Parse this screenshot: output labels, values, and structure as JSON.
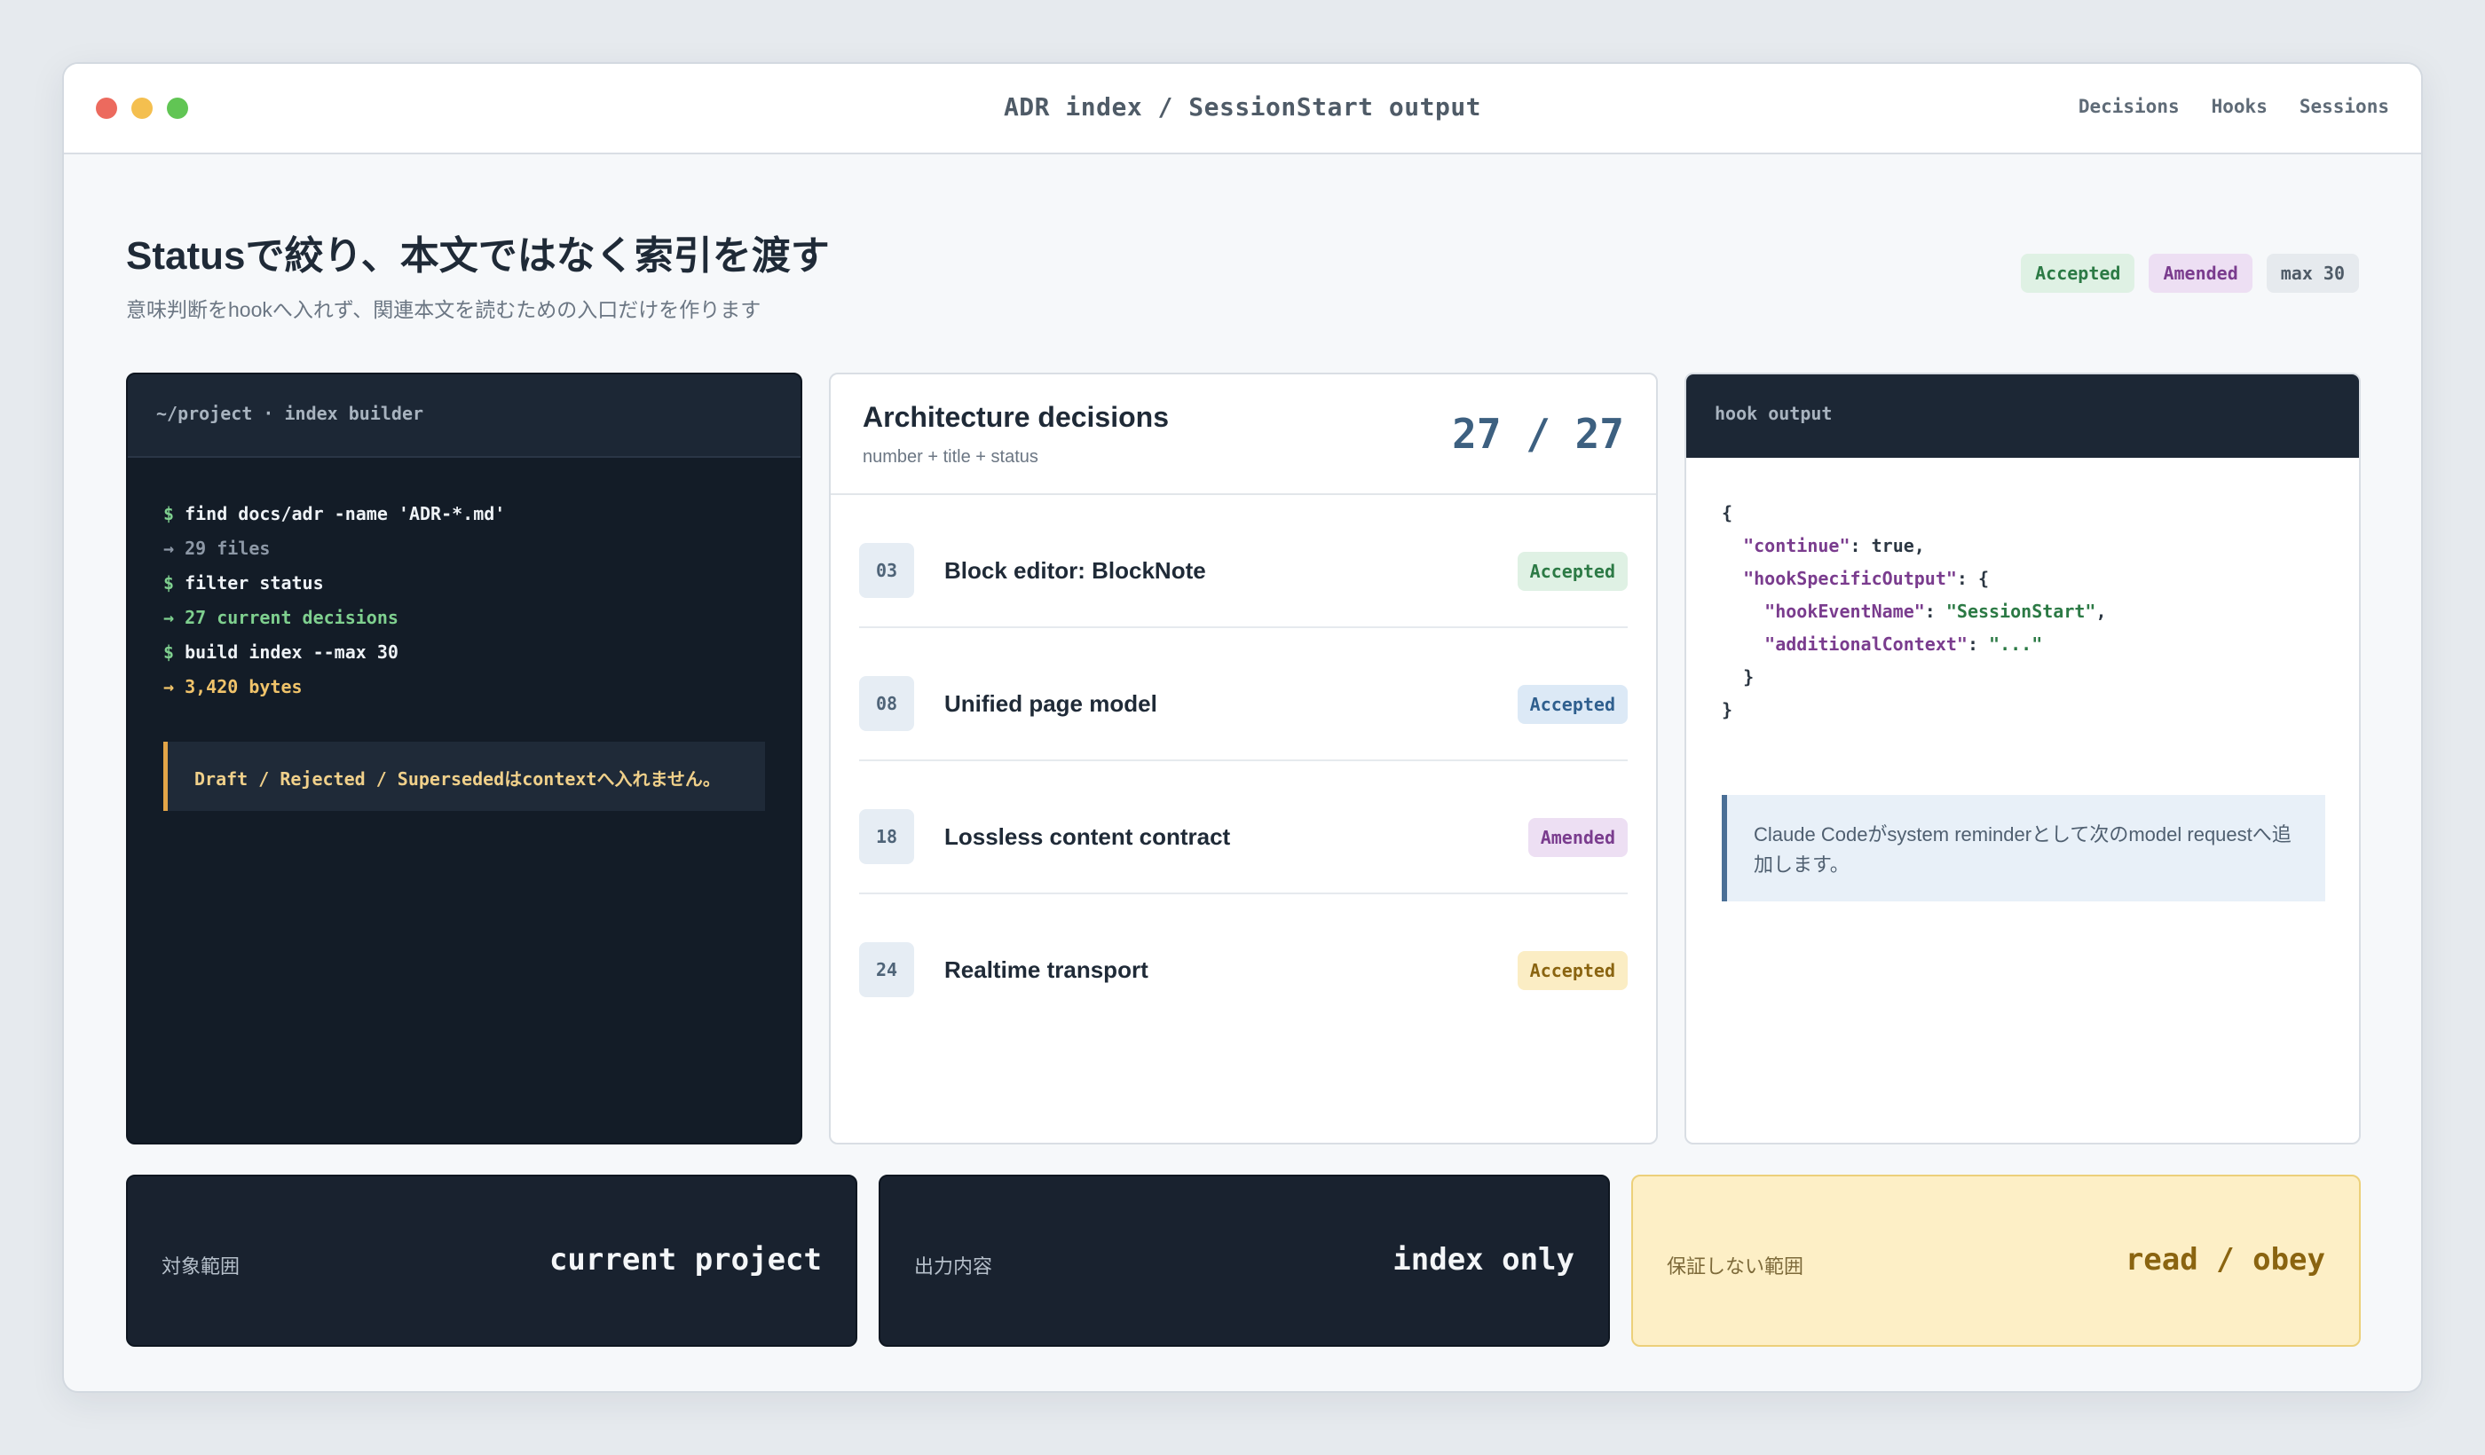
{
  "window": {
    "title": "ADR index / SessionStart output",
    "nav": [
      "Decisions",
      "Hooks",
      "Sessions"
    ]
  },
  "header": {
    "title": "Statusで絞り、本文ではなく索引を渡す",
    "subtitle": "意味判断をhookへ入れず、関連本文を読むための入口だけを作ります",
    "tags": [
      {
        "label": "Accepted",
        "kind": "accepted"
      },
      {
        "label": "Amended",
        "kind": "amended"
      },
      {
        "label": "max 30",
        "kind": "max"
      }
    ]
  },
  "terminal": {
    "title": "~/project · index builder",
    "lines": [
      {
        "prefix": "$",
        "text": "find docs/adr -name 'ADR-*.md'",
        "color": "white"
      },
      {
        "prefix": "→",
        "text": "29 files",
        "color": "gray"
      },
      {
        "prefix": "$",
        "text": "filter status",
        "color": "white"
      },
      {
        "prefix": "→",
        "text": "27 current decisions",
        "color": "green"
      },
      {
        "prefix": "$",
        "text": "build index --max 30",
        "color": "white"
      },
      {
        "prefix": "→",
        "text": "3,420 bytes",
        "color": "yellow"
      }
    ],
    "note": "Draft / Rejected / Supersededはcontextへ入れません。"
  },
  "decisions": {
    "title": "Architecture decisions",
    "subtitle": "number + title + status",
    "count": "27 / 27",
    "items": [
      {
        "num": "03",
        "title": "Block editor: BlockNote",
        "status": "Accepted",
        "color": "green"
      },
      {
        "num": "08",
        "title": "Unified page model",
        "status": "Accepted",
        "color": "blue"
      },
      {
        "num": "18",
        "title": "Lossless content contract",
        "status": "Amended",
        "color": "purple"
      },
      {
        "num": "24",
        "title": "Realtime transport",
        "status": "Accepted",
        "color": "yellow"
      }
    ]
  },
  "hook": {
    "title": "hook output",
    "json": {
      "open": "{",
      "continue_key": "\"continue\"",
      "continue_val": "true",
      "hso_key": "\"hookSpecificOutput\"",
      "event_key": "\"hookEventName\"",
      "event_val": "\"SessionStart\"",
      "ctx_key": "\"additionalContext\"",
      "ctx_val": "\"...\"",
      "inner_close": "}",
      "close": "}"
    },
    "note": "Claude Codeがsystem reminderとして次のmodel requestへ追加します。"
  },
  "cards": [
    {
      "label": "対象範囲",
      "value": "current project"
    },
    {
      "label": "出力内容",
      "value": "index only"
    },
    {
      "label": "保証しない範囲",
      "value": "read / obey"
    }
  ]
}
